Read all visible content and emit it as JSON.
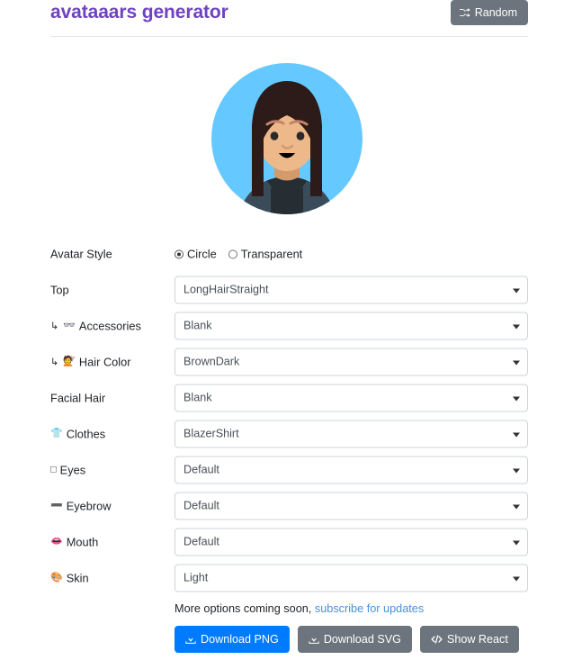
{
  "header": {
    "title": "avataaars generator",
    "random_button": {
      "label": "Random",
      "icon": "shuffle-icon"
    },
    "random_button_color": "#6c757d",
    "title_color": "#6f42c1"
  },
  "avatar": {
    "style": "Circle",
    "background_color": "#65c9ff",
    "skin_color": "#edb98a",
    "hair_color": "#2c1b18",
    "clothes_color": "#262e33",
    "clothes_collar_color": "#3a4c5a",
    "alt": "avatar-preview"
  },
  "form": {
    "avatar_style": {
      "label": "Avatar Style",
      "options": [
        "Circle",
        "Transparent"
      ],
      "selected": "Circle"
    },
    "rows": [
      {
        "icon": "",
        "sub": false,
        "label": "Top",
        "value": "LongHairStraight",
        "name": "top"
      },
      {
        "icon": "👓",
        "sub": true,
        "label": "Accessories",
        "value": "Blank",
        "name": "accessories"
      },
      {
        "icon": "💇",
        "sub": true,
        "label": "Hair Color",
        "value": "BrownDark",
        "name": "hair-color"
      },
      {
        "icon": "",
        "sub": false,
        "label": "Facial Hair",
        "value": "Blank",
        "name": "facial-hair"
      },
      {
        "icon": "👕",
        "sub": false,
        "label": "Clothes",
        "value": "BlazerShirt",
        "name": "clothes"
      },
      {
        "icon": "□",
        "sub": false,
        "label": "Eyes",
        "value": "Default",
        "name": "eyes"
      },
      {
        "icon": "➖",
        "sub": false,
        "label": "Eyebrow",
        "value": "Default",
        "name": "eyebrow"
      },
      {
        "icon": "👄",
        "sub": false,
        "label": "Mouth",
        "value": "Default",
        "name": "mouth"
      },
      {
        "icon": "🎨",
        "sub": false,
        "label": "Skin",
        "value": "Light",
        "name": "skin"
      }
    ]
  },
  "footer": {
    "more_options_text": "More options coming soon,",
    "subscribe_link": "subscribe for updates",
    "link_color": "#4a90d9",
    "buttons": [
      {
        "label": "Download PNG",
        "icon": "download-icon",
        "style": "primary",
        "color": "#007bff"
      },
      {
        "label": "Download SVG",
        "icon": "download-icon",
        "style": "secondary",
        "color": "#6c757d"
      },
      {
        "label": "Show React",
        "icon": "code-icon",
        "style": "secondary",
        "color": "#6c757d"
      }
    ]
  }
}
